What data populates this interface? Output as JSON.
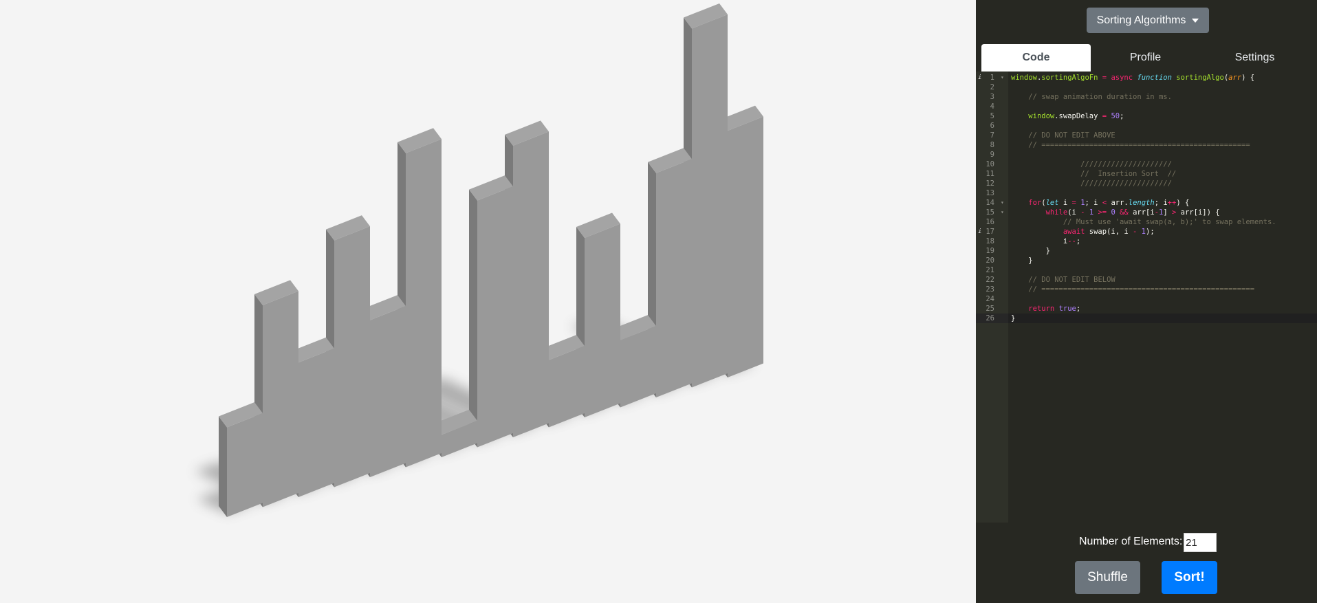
{
  "dropdown": {
    "label": "Sorting Algorithms"
  },
  "tabs": [
    {
      "label": "Code",
      "active": true
    },
    {
      "label": "Profile",
      "active": false
    },
    {
      "label": "Settings",
      "active": false
    }
  ],
  "editor": {
    "active_line": 26,
    "lines": [
      {
        "n": "1",
        "fold": true,
        "info": true,
        "tokens": [
          [
            "g",
            "window"
          ],
          [
            "t",
            "."
          ],
          [
            "g",
            "sortingAlgoFn"
          ],
          [
            "t",
            " "
          ],
          [
            "k",
            "="
          ],
          [
            "t",
            " "
          ],
          [
            "k",
            "async"
          ],
          [
            "t",
            " "
          ],
          [
            "s",
            "function"
          ],
          [
            "t",
            " "
          ],
          [
            "g",
            "sortingAlgo"
          ],
          [
            "t",
            "("
          ],
          [
            "p",
            "arr"
          ],
          [
            "t",
            ") {"
          ]
        ]
      },
      {
        "n": "2",
        "tokens": []
      },
      {
        "n": "3",
        "tokens": [
          [
            "t",
            "    "
          ],
          [
            "c",
            "// swap animation duration in ms."
          ]
        ]
      },
      {
        "n": "4",
        "tokens": []
      },
      {
        "n": "5",
        "tokens": [
          [
            "t",
            "    "
          ],
          [
            "g",
            "window"
          ],
          [
            "t",
            ".swapDelay "
          ],
          [
            "k",
            "="
          ],
          [
            "t",
            " "
          ],
          [
            "n",
            "50"
          ],
          [
            "t",
            ";"
          ]
        ]
      },
      {
        "n": "6",
        "tokens": []
      },
      {
        "n": "7",
        "tokens": [
          [
            "t",
            "    "
          ],
          [
            "c",
            "// DO NOT EDIT ABOVE"
          ]
        ]
      },
      {
        "n": "8",
        "tokens": [
          [
            "t",
            "    "
          ],
          [
            "c",
            "// ================================================"
          ]
        ]
      },
      {
        "n": "9",
        "tokens": []
      },
      {
        "n": "10",
        "tokens": [
          [
            "t",
            "                "
          ],
          [
            "c",
            "/////////////////////"
          ]
        ]
      },
      {
        "n": "11",
        "tokens": [
          [
            "t",
            "                "
          ],
          [
            "c",
            "//  Insertion Sort  //"
          ]
        ]
      },
      {
        "n": "12",
        "tokens": [
          [
            "t",
            "                "
          ],
          [
            "c",
            "/////////////////////"
          ]
        ]
      },
      {
        "n": "13",
        "tokens": []
      },
      {
        "n": "14",
        "fold": true,
        "tokens": [
          [
            "t",
            "    "
          ],
          [
            "k",
            "for"
          ],
          [
            "t",
            "("
          ],
          [
            "s",
            "let"
          ],
          [
            "t",
            " i "
          ],
          [
            "k",
            "="
          ],
          [
            "t",
            " "
          ],
          [
            "n",
            "1"
          ],
          [
            "t",
            "; i "
          ],
          [
            "k",
            "<"
          ],
          [
            "t",
            " arr."
          ],
          [
            "s",
            "length"
          ],
          [
            "t",
            "; i"
          ],
          [
            "k",
            "++"
          ],
          [
            "t",
            ") {"
          ]
        ]
      },
      {
        "n": "15",
        "fold": true,
        "tokens": [
          [
            "t",
            "        "
          ],
          [
            "k",
            "while"
          ],
          [
            "t",
            "(i "
          ],
          [
            "k",
            "-"
          ],
          [
            "t",
            " "
          ],
          [
            "n",
            "1"
          ],
          [
            "t",
            " "
          ],
          [
            "k",
            ">="
          ],
          [
            "t",
            " "
          ],
          [
            "n",
            "0"
          ],
          [
            "t",
            " "
          ],
          [
            "k",
            "&&"
          ],
          [
            "t",
            " arr[i"
          ],
          [
            "k",
            "-"
          ],
          [
            "n",
            "1"
          ],
          [
            "t",
            "] "
          ],
          [
            "k",
            ">"
          ],
          [
            "t",
            " arr[i]) {"
          ]
        ]
      },
      {
        "n": "16",
        "tokens": [
          [
            "t",
            "            "
          ],
          [
            "c",
            "// Must use 'await swap(a, b);' to swap elements."
          ]
        ]
      },
      {
        "n": "17",
        "info": true,
        "tokens": [
          [
            "t",
            "            "
          ],
          [
            "k",
            "await"
          ],
          [
            "t",
            " swap(i, i "
          ],
          [
            "k",
            "-"
          ],
          [
            "t",
            " "
          ],
          [
            "n",
            "1"
          ],
          [
            "t",
            ");"
          ]
        ]
      },
      {
        "n": "18",
        "tokens": [
          [
            "t",
            "            i"
          ],
          [
            "k",
            "--"
          ],
          [
            "t",
            ";"
          ]
        ]
      },
      {
        "n": "19",
        "tokens": [
          [
            "t",
            "        }"
          ]
        ]
      },
      {
        "n": "20",
        "tokens": [
          [
            "t",
            "    }"
          ]
        ]
      },
      {
        "n": "21",
        "tokens": []
      },
      {
        "n": "22",
        "tokens": [
          [
            "t",
            "    "
          ],
          [
            "c",
            "// DO NOT EDIT BELOW"
          ]
        ]
      },
      {
        "n": "23",
        "tokens": [
          [
            "t",
            "    "
          ],
          [
            "c",
            "// ================================================="
          ]
        ]
      },
      {
        "n": "24",
        "tokens": []
      },
      {
        "n": "25",
        "tokens": [
          [
            "t",
            "    "
          ],
          [
            "k",
            "return"
          ],
          [
            "t",
            " "
          ],
          [
            "n",
            "true"
          ],
          [
            "t",
            ";"
          ]
        ]
      },
      {
        "n": "26",
        "tokens": [
          [
            "t",
            "}"
          ]
        ]
      }
    ]
  },
  "controls": {
    "num_label": "Number of Elements:",
    "num_value": "21",
    "shuffle_label": "Shuffle",
    "sort_label": "Sort!"
  },
  "visualization": {
    "bar_color": "#999999",
    "values": [
      4,
      9,
      6,
      11,
      7,
      14,
      1,
      11,
      13,
      3,
      8,
      3,
      10,
      16,
      11
    ]
  }
}
